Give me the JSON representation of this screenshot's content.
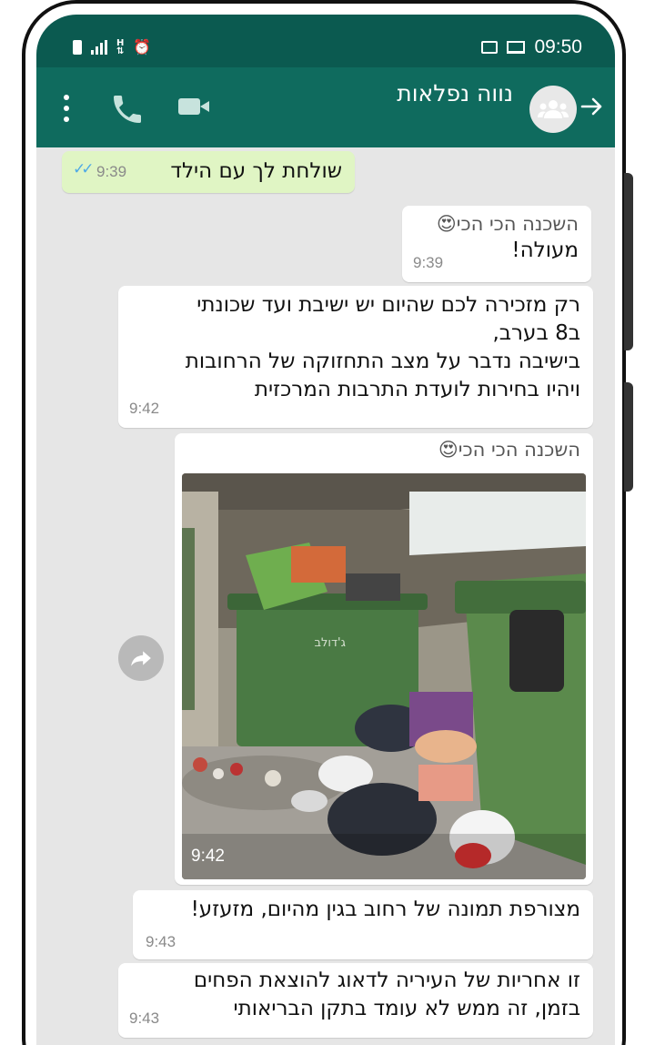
{
  "status_bar": {
    "time": "09:50",
    "network_label": "H",
    "icons": [
      "battery-icon",
      "signal-icon",
      "alarm-icon",
      "gallery-icon",
      "laptop-icon"
    ]
  },
  "header": {
    "chat_title": "נווה נפלאות",
    "avatar": "group-avatar-icon",
    "icons": [
      "menu-icon",
      "call-icon",
      "video-icon",
      "back-arrow-icon"
    ]
  },
  "messages": [
    {
      "direction": "outgoing",
      "text": "שולחת לך עם הילד",
      "time": "9:39",
      "status": "read"
    },
    {
      "direction": "incoming",
      "sender": "השכנה הכי הכי",
      "sender_emoji": "😍",
      "text": "מעולה!",
      "time": "9:39"
    },
    {
      "direction": "incoming",
      "lines": [
        "רק מזכירה לכם שהיום יש ישיבת ועד שכונתי",
        "ב8 בערב,",
        "בישיבה נדבר על מצב התחזוקה של הרחובות",
        "ויהיו בחירות לועדת התרבות המרכזית"
      ],
      "time": "9:42"
    },
    {
      "direction": "incoming",
      "sender": "השכנה הכי הכי",
      "sender_emoji": "😍",
      "type": "image",
      "image_text": "ג'דולב",
      "time": "9:42"
    },
    {
      "direction": "incoming",
      "text": "מצורפת תמונה של רחוב בגין מהיום, מזעזע!",
      "time": "9:43"
    },
    {
      "direction": "incoming",
      "lines": [
        "זו אחריות של העיריה לדאוג להוצאת הפחים",
        "בזמן, זה ממש לא עומד בתקן הבריאותי"
      ],
      "time": "9:43"
    }
  ],
  "colors": {
    "header": "#0f6b5e",
    "status_bar": "#0b5a50",
    "outgoing_bubble": "#e0f5c4",
    "chat_bg": "#e6e6e6",
    "read_ticks": "#4fa9e6"
  }
}
